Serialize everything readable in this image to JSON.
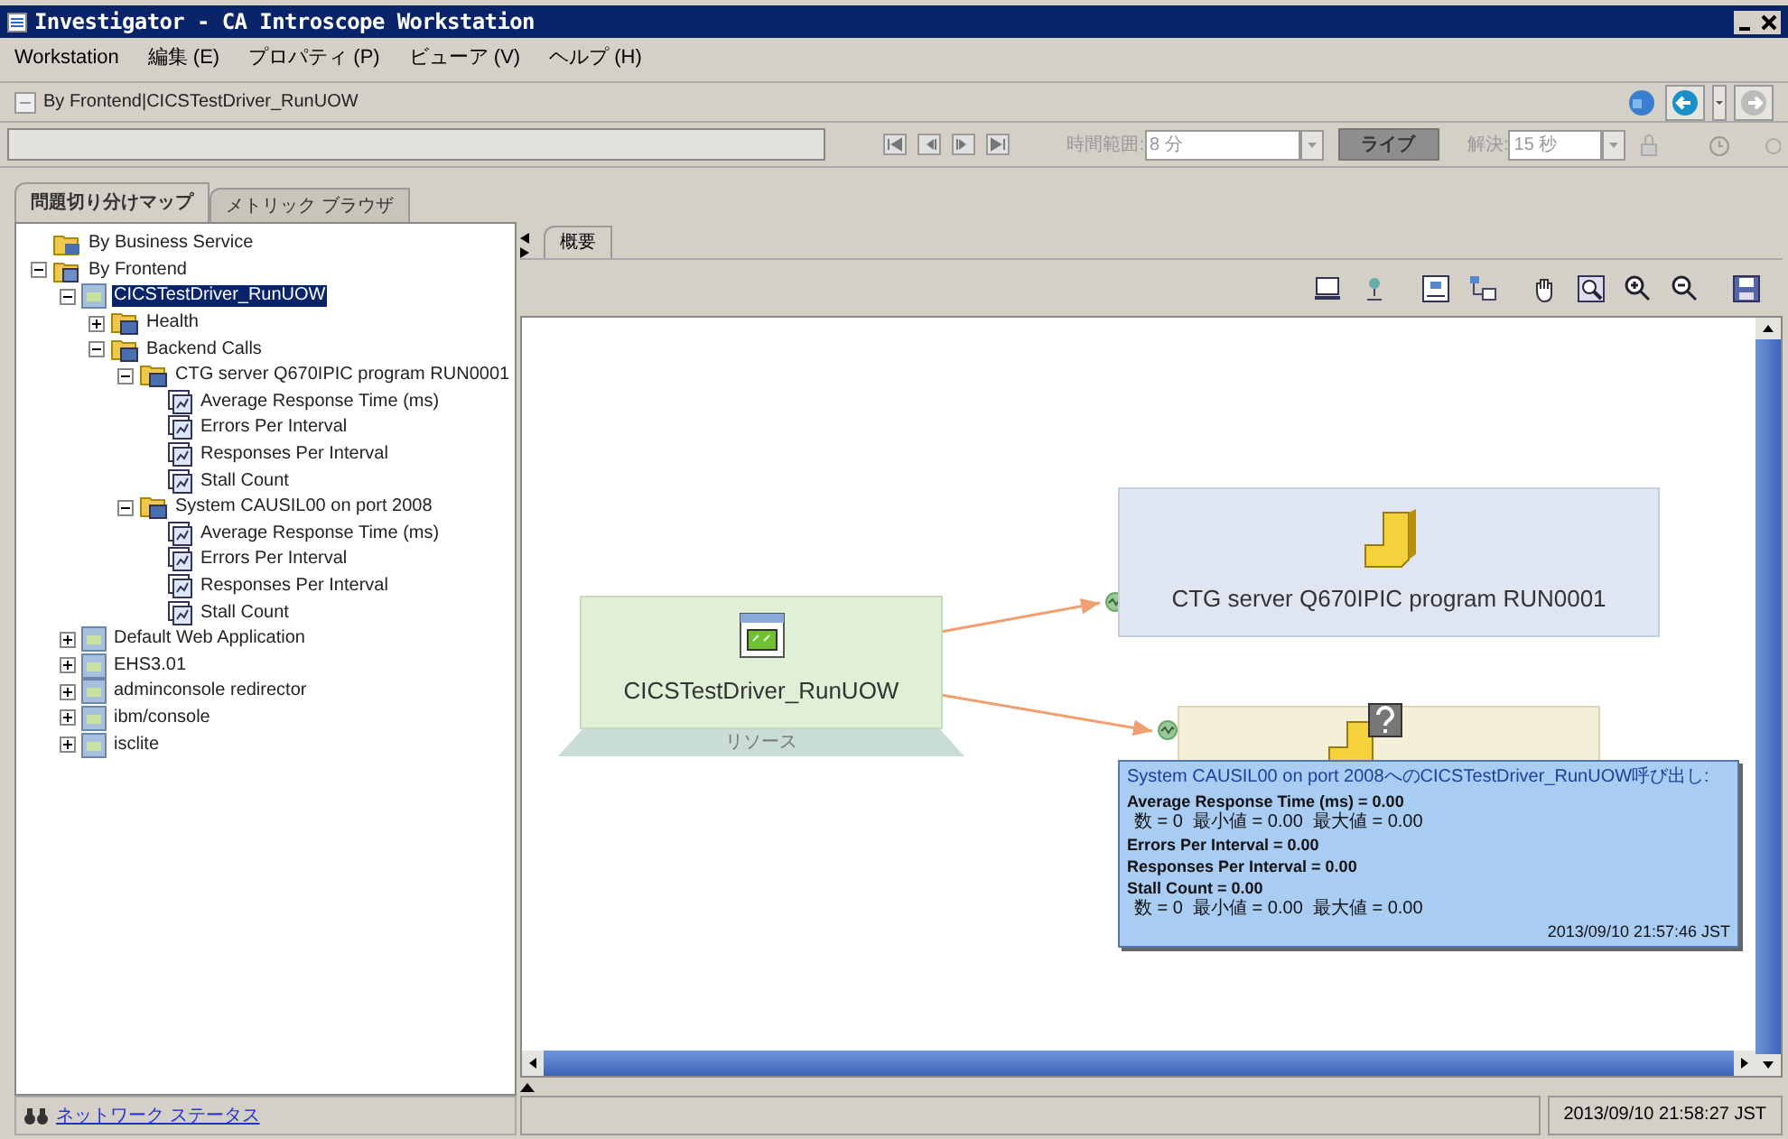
{
  "window": {
    "title": "Investigator - CA Introscope Workstation"
  },
  "menu": [
    {
      "label": "Workstation"
    },
    {
      "label": "編集 (E)"
    },
    {
      "label": "プロパティ (P)"
    },
    {
      "label": "ビューア (V)"
    },
    {
      "label": "ヘルプ (H)"
    }
  ],
  "breadcrumb": "By Frontend|CICSTestDriver_RunUOW",
  "timebar": {
    "time_range_label": "時間範囲:",
    "time_range_value": "8 分",
    "live_button": "ライブ",
    "resolution_label": "解決:",
    "resolution_value": "15 秒"
  },
  "main_tabs": [
    {
      "label": "問題切り分けマップ",
      "selected": true
    },
    {
      "label": "メトリック ブラウザ",
      "selected": false
    }
  ],
  "tree": [
    {
      "label": "By Business Service",
      "kind": "business",
      "selected": false
    },
    {
      "label": "By Frontend",
      "kind": "group",
      "selected": false,
      "expanded": true,
      "children": [
        {
          "label": "CICSTestDriver_RunUOW",
          "kind": "app",
          "selected": true,
          "expanded": true,
          "children": [
            {
              "label": "Health",
              "kind": "folder",
              "selected": false,
              "expanded": false
            },
            {
              "label": "Backend Calls",
              "kind": "folder",
              "selected": false,
              "expanded": true,
              "children": [
                {
                  "label": "CTG server Q670IPIC program RUN0001",
                  "kind": "folder",
                  "selected": false,
                  "expanded": true,
                  "children": [
                    {
                      "label": "Average Response Time (ms)",
                      "kind": "metric",
                      "selected": false
                    },
                    {
                      "label": "Errors Per Interval",
                      "kind": "metric",
                      "selected": false
                    },
                    {
                      "label": "Responses Per Interval",
                      "kind": "metric",
                      "selected": false
                    },
                    {
                      "label": "Stall Count",
                      "kind": "metric",
                      "selected": false
                    }
                  ]
                },
                {
                  "label": "System CAUSIL00 on port 2008",
                  "kind": "folder",
                  "selected": false,
                  "expanded": true,
                  "children": [
                    {
                      "label": "Average Response Time (ms)",
                      "kind": "metric",
                      "selected": false
                    },
                    {
                      "label": "Errors Per Interval",
                      "kind": "metric",
                      "selected": false
                    },
                    {
                      "label": "Responses Per Interval",
                      "kind": "metric",
                      "selected": false
                    },
                    {
                      "label": "Stall Count",
                      "kind": "metric",
                      "selected": false
                    }
                  ]
                }
              ]
            }
          ]
        },
        {
          "label": "Default Web Application",
          "kind": "app",
          "selected": false,
          "expanded": false
        },
        {
          "label": "EHS3.01",
          "kind": "app",
          "selected": false,
          "expanded": false
        },
        {
          "label": "adminconsole redirector",
          "kind": "app",
          "selected": false,
          "expanded": false
        },
        {
          "label": "ibm/console",
          "kind": "app",
          "selected": false,
          "expanded": false
        },
        {
          "label": "isclite",
          "kind": "app",
          "selected": false,
          "expanded": false
        }
      ]
    }
  ],
  "view_tabs": [
    {
      "label": "概要",
      "selected": true
    }
  ],
  "map": {
    "nodes": [
      {
        "kind": "source",
        "label": "CICSTestDriver_RunUOW",
        "footer": "リソース"
      },
      {
        "kind": "backend",
        "label": "CTG server Q670IPIC program RUN0001"
      },
      {
        "kind": "backend_unknown"
      }
    ],
    "tooltip": {
      "title": "System CAUSIL00  on port 2008へのCICSTestDriver_RunUOW呼び出し:",
      "lines": [
        {
          "kind": "metric",
          "text": "Average Response Time (ms) = 0.00"
        },
        {
          "kind": "detail",
          "text": "数 = 0  最小値 = 0.00  最大値 = 0.00"
        },
        {
          "kind": "metric",
          "text": "Errors Per Interval = 0.00"
        },
        {
          "kind": "metric",
          "text": "Responses Per Interval = 0.00"
        },
        {
          "kind": "metric",
          "text": "Stall Count = 0.00"
        },
        {
          "kind": "detail",
          "text": "数 = 0  最小値 = 0.00  最大値 = 0.00"
        }
      ],
      "timestamp": "2013/09/10 21:57:46 JST"
    }
  },
  "status_bar": {
    "network_status": "ネットワーク ステータス",
    "timestamp": "2013/09/10 21:58:27 JST"
  }
}
